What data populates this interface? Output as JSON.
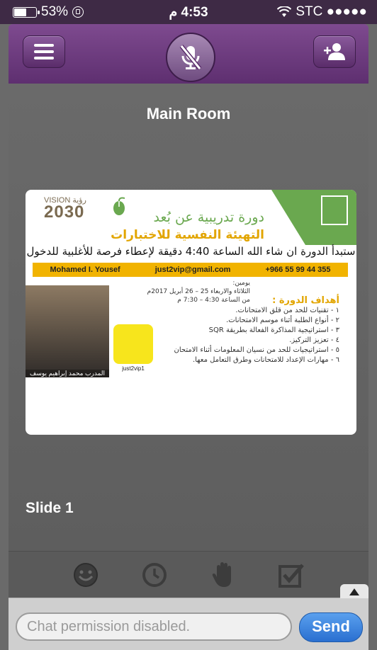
{
  "status_bar": {
    "battery": "53%",
    "time": "4:53 م",
    "carrier": "STC ●●●●●"
  },
  "header": {
    "menu_label": "menu",
    "mic_label": "mute",
    "users_label": "participants"
  },
  "room": {
    "title": "Main Room",
    "slide_label": "Slide 1"
  },
  "slide_content": {
    "vision_small": "VISION رؤية",
    "vision_year": "2030",
    "title_line1": "دورة تدريبية عن بُعد",
    "title_line2": "التهيئة النفسية للاختبارات",
    "start_note": "ستبدأ الدورة ان شاء الله الساعة 4:40 دقيقة لإعطاء فرصة للأغلبية للدخول",
    "trainer_name": "Mohamed I. Yousef",
    "email": "just2vip@gmail.com",
    "phone": "+966 55 99 44 355",
    "days": "يومين:",
    "date_line": "الثلاثاء والاربعاء 25 – 26 أبريل 2017م",
    "time_line": "من الساعة 4:30 – 7:30 م",
    "goals_title": "أهداف الدورة :",
    "goals": [
      "١ - تقنيات للحد من قلق الامتحانات.",
      "٢ - أنواع الطلبة أثناء موسم الامتحانات.",
      "٣ - استراتيجية المذاكرة الفعالة بطريقة SQR",
      "٤ - تعزيز التركيز.",
      "٥ - استراتيجيات للحد من نسيان المعلومات أثناء الامتحان",
      "٦ - مهارات الإعداد للامتحانات وطرق التعامل معها."
    ],
    "photo_caption": "المدرب محمد إبراهيم يوسف",
    "snap_handle": "just2vip1"
  },
  "toolbar": {
    "items": [
      "smiley-icon",
      "clock-icon",
      "hand-icon",
      "checkbox-icon"
    ]
  },
  "chat": {
    "placeholder": "Chat permission disabled.",
    "send_label": "Send"
  },
  "colors": {
    "purple": "#6b3a7e",
    "send_blue": "#2f7fe0",
    "room_bg": "#666666"
  }
}
